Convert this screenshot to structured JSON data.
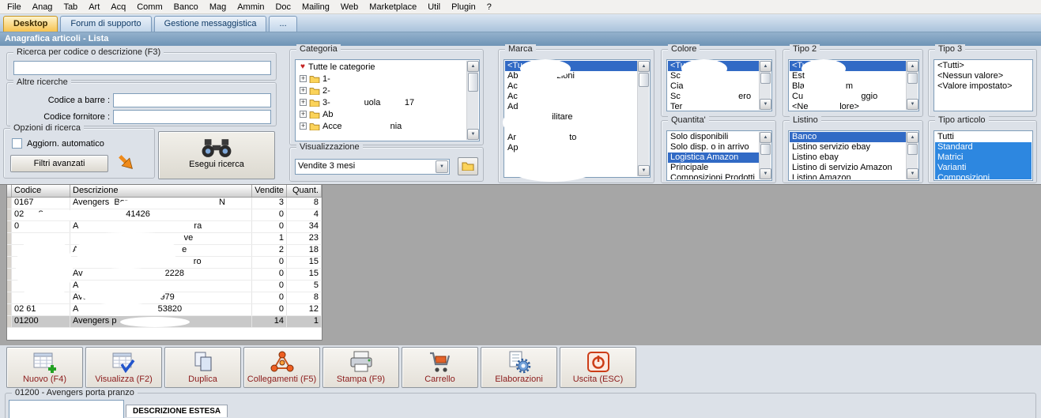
{
  "icons": {
    "heart": "♥",
    "expand_plus": "+",
    "scroll_up": "▲",
    "scroll_down": "▼",
    "combo_arrow": "▼"
  },
  "colors": {
    "selection_blue": "#316ac5",
    "selection_light_blue": "#2d87e0",
    "active_tab_orange": "#f7c34f",
    "toolbar_label_red": "#8b1a1a"
  },
  "menu": {
    "items": [
      "File",
      "Anag",
      "Tab",
      "Art",
      "Acq",
      "Comm",
      "Banco",
      "Mag",
      "Ammin",
      "Doc",
      "Mailing",
      "Web",
      "Marketplace",
      "Util",
      "Plugin",
      "?"
    ]
  },
  "tabs": {
    "items": [
      {
        "label": "Desktop",
        "active": true
      },
      {
        "label": "Forum di supporto",
        "active": false
      },
      {
        "label": "Gestione messaggistica",
        "active": false
      },
      {
        "label": "...",
        "active": false
      }
    ]
  },
  "title_bar": {
    "title": "Anagrafica articoli  - Lista"
  },
  "search": {
    "ricerca_title": "Ricerca per codice o descrizione (F3)",
    "ricerca_value": "",
    "altre_title": "Altre ricerche",
    "barcode_label": "Codice a barre :",
    "barcode_value": "",
    "fornitore_label": "Codice fornitore :",
    "fornitore_value": "",
    "opzioni_title": "Opzioni di ricerca",
    "auto_update_label": "Aggiorn. automatico",
    "filtri_button": "Filtri avanzati",
    "esegui_button": "Esegui ricerca"
  },
  "categoria": {
    "title": "Categoria",
    "items": [
      {
        "icon": "heart",
        "label": "Tutte le categorie"
      },
      {
        "icon": "folder",
        "expand": true,
        "label": "1-"
      },
      {
        "icon": "folder",
        "expand": true,
        "label": "2-"
      },
      {
        "icon": "folder",
        "expand": true,
        "label": "3-              uola          17"
      },
      {
        "icon": "folder",
        "expand": true,
        "label": "Ab"
      },
      {
        "icon": "folder",
        "expand": true,
        "label": "Acce                    nia"
      }
    ]
  },
  "visualizzazione": {
    "title": "Visualizzazione",
    "selected": "Vendite 3 mesi"
  },
  "marca": {
    "title": "Marca",
    "items": [
      {
        "label": "<Tu",
        "selected": true
      },
      {
        "label": "Ab                zioni"
      },
      {
        "label": "Ac"
      },
      {
        "label": "Ac"
      },
      {
        "label": "Ad"
      },
      {
        "label": "Ae              ilitare"
      },
      {
        "label": "Ar"
      },
      {
        "label": "Ar                      to"
      },
      {
        "label": "Ap"
      }
    ]
  },
  "colore": {
    "title": "Colore",
    "items": [
      {
        "label": "<Tu",
        "selected": true
      },
      {
        "label": "Sc"
      },
      {
        "label": "Cia"
      },
      {
        "label": "Sc                        ero"
      },
      {
        "label": "Ter"
      }
    ]
  },
  "quantita": {
    "title": "Quantita'",
    "items": [
      {
        "label": "Solo disponibili"
      },
      {
        "label": "Solo disp. o in arrivo"
      },
      {
        "label": "Logistica Amazon",
        "selected": true
      },
      {
        "label": "Principale"
      },
      {
        "label": "Composizioni Prodotti"
      }
    ]
  },
  "tipo2": {
    "title": "Tipo 2",
    "items": [
      {
        "label": "<Tu",
        "selected": true
      },
      {
        "label": "Est"
      },
      {
        "label": "Bla                 m"
      },
      {
        "label": "Cu                        ggio"
      },
      {
        "label": "<Ne             lore>"
      }
    ]
  },
  "listino": {
    "title": "Listino",
    "items": [
      {
        "label": "Banco",
        "selected": true
      },
      {
        "label": "Listino servizio ebay"
      },
      {
        "label": "Listino ebay"
      },
      {
        "label": "Listino di servizio Amazon"
      },
      {
        "label": "Listino Amazon"
      }
    ]
  },
  "tipo3": {
    "title": "Tipo 3",
    "items": [
      {
        "label": "<Tutti>"
      },
      {
        "label": "<Nessun valore>"
      },
      {
        "label": "<Valore impostato>"
      }
    ]
  },
  "tipo_articolo": {
    "title": "Tipo articolo",
    "items": [
      {
        "label": "Tutti"
      },
      {
        "label": "Standard",
        "selected2": true
      },
      {
        "label": "Matrici",
        "selected2": true
      },
      {
        "label": "Varianti",
        "selected2": true
      },
      {
        "label": "Composizioni",
        "selected2": true
      }
    ]
  },
  "table": {
    "headers": [
      "Codice",
      "Descrizione",
      "Vendite",
      "Quant."
    ],
    "rows": [
      {
        "codice": "0167",
        "descrizione": "Avengers  Borsa                                  N",
        "vendite": "3",
        "quant": "8"
      },
      {
        "codice": "02      8",
        "descrizione": "                      41426",
        "vendite": "0",
        "quant": "4"
      },
      {
        "codice": "0",
        "descrizione": "A                                                ra",
        "vendite": "0",
        "quant": "34"
      },
      {
        "codice": "",
        "descrizione": "                                              ve",
        "vendite": "1",
        "quant": "23"
      },
      {
        "codice": "",
        "descrizione": "A                                           e",
        "vendite": "2",
        "quant": "18"
      },
      {
        "codice": "",
        "descrizione": "                                                  ro",
        "vendite": "0",
        "quant": "15"
      },
      {
        "codice": "",
        "descrizione": "Av                                  2228",
        "vendite": "0",
        "quant": "15"
      },
      {
        "codice": "",
        "descrizione": "A",
        "vendite": "0",
        "quant": "5"
      },
      {
        "codice": "",
        "descrizione": "Ave                              979",
        "vendite": "0",
        "quant": "8"
      },
      {
        "codice": "02 61",
        "descrizione": "A                                 53820",
        "vendite": "0",
        "quant": "12"
      },
      {
        "codice": "01200",
        "descrizione": "Avengers p",
        "vendite": "14",
        "quant": "1",
        "selected": true
      }
    ]
  },
  "toolbar": {
    "buttons": [
      {
        "label": "Nuovo (F4)",
        "icon": "new-record-icon"
      },
      {
        "label": "Visualizza (F2)",
        "icon": "view-record-icon"
      },
      {
        "label": "Duplica",
        "icon": "duplicate-icon"
      },
      {
        "label": "Collegamenti (F5)",
        "icon": "links-icon"
      },
      {
        "label": "Stampa (F9)",
        "icon": "print-icon"
      },
      {
        "label": "Carrello",
        "icon": "cart-icon"
      },
      {
        "label": "Elaborazioni",
        "icon": "process-icon"
      },
      {
        "label": "Uscita (ESC)",
        "icon": "exit-icon"
      }
    ]
  },
  "bottom": {
    "record_title": "01200 - Avengers porta pranzo",
    "tab_label": "DESCRIZIONE ESTESA"
  }
}
